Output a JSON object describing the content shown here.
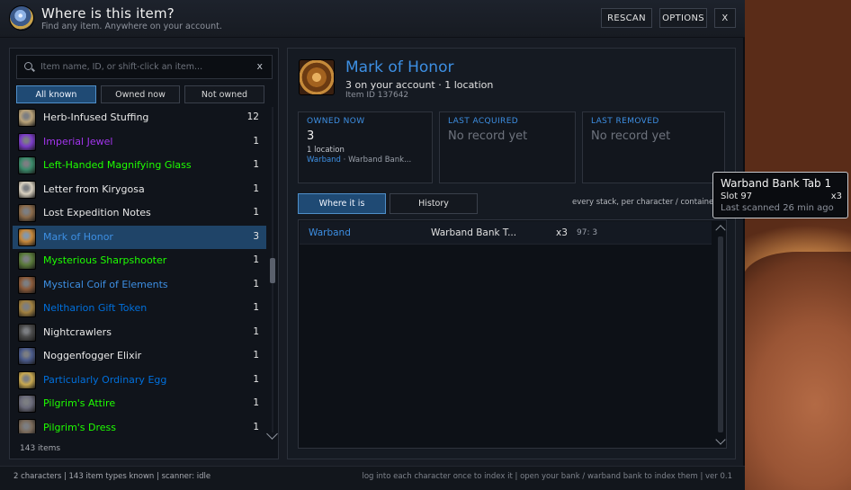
{
  "header": {
    "title": "Where is this item?",
    "subtitle": "Find any item. Anywhere on your account.",
    "rescan": "RESCAN",
    "options": "OPTIONS",
    "close": "X"
  },
  "search": {
    "placeholder": "Item name, ID, or shift-click an item...",
    "clear": "x"
  },
  "filters": [
    "All known",
    "Owned now",
    "Not owned"
  ],
  "items": [
    {
      "name": "Herb-Infused Stuffing",
      "count": "12",
      "color": "#e8e8e8",
      "icon": "stuffing-icon",
      "iconbg": "#b9a37a"
    },
    {
      "name": "Imperial Jewel",
      "count": "1",
      "color": "#a335ee",
      "icon": "jewel-icon",
      "iconbg": "#7a3cc8"
    },
    {
      "name": "Left-Handed Magnifying Glass",
      "count": "1",
      "color": "#1eff00",
      "icon": "magnifying-glass-icon",
      "iconbg": "#3a8a6a"
    },
    {
      "name": "Letter from Kirygosa",
      "count": "1",
      "color": "#e8e8e8",
      "icon": "letter-icon",
      "iconbg": "#d8d0c0"
    },
    {
      "name": "Lost Expedition Notes",
      "count": "1",
      "color": "#e8e8e8",
      "icon": "notes-icon",
      "iconbg": "#8a6a4a"
    },
    {
      "name": "Mark of Honor",
      "count": "3",
      "color": "#3d8fe3",
      "icon": "mark-of-honor-icon",
      "iconbg": "#c5873a",
      "selected": true
    },
    {
      "name": "Mysterious Sharpshooter",
      "count": "1",
      "color": "#1eff00",
      "icon": "sharpshooter-icon",
      "iconbg": "#5a7a3a"
    },
    {
      "name": "Mystical Coif of Elements",
      "count": "1",
      "color": "#3d8fe3",
      "icon": "coif-icon",
      "iconbg": "#8a5a3a"
    },
    {
      "name": "Neltharion Gift Token",
      "count": "1",
      "color": "#0070dd",
      "icon": "token-icon",
      "iconbg": "#a08040"
    },
    {
      "name": "Nightcrawlers",
      "count": "1",
      "color": "#e8e8e8",
      "icon": "nightcrawlers-icon",
      "iconbg": "#4a4a4a"
    },
    {
      "name": "Noggenfogger Elixir",
      "count": "1",
      "color": "#e8e8e8",
      "icon": "elixir-icon",
      "iconbg": "#4a5a8a"
    },
    {
      "name": "Particularly Ordinary Egg",
      "count": "1",
      "color": "#0070dd",
      "icon": "egg-icon",
      "iconbg": "#c8a850"
    },
    {
      "name": "Pilgrim's Attire",
      "count": "1",
      "color": "#1eff00",
      "icon": "attire-icon",
      "iconbg": "#6a6a7a"
    },
    {
      "name": "Pilgrim's Dress",
      "count": "1",
      "color": "#1eff00",
      "icon": "dress-icon",
      "iconbg": "#7a6a5a"
    }
  ],
  "item_count": "143 items",
  "detail": {
    "name": "Mark of Honor",
    "summary": "3 on your account  ·  1 location",
    "item_id": "Item ID 137642",
    "owned_label": "OWNED NOW",
    "owned_value": "3",
    "owned_locations": "1 location",
    "owned_loc_a": "Warband",
    "owned_loc_sep": "·",
    "owned_loc_b": "Warband Bank...",
    "acquired_label": "LAST ACQUIRED",
    "acquired_value": "No record yet",
    "removed_label": "LAST REMOVED",
    "removed_value": "No record yet"
  },
  "tabs": [
    "Where it is",
    "History"
  ],
  "hint": "every stack, per character / container",
  "table": [
    {
      "owner": "Warband",
      "container": "Warband Bank T...",
      "qty": "x3",
      "slot": "97: 3"
    }
  ],
  "tooltip": {
    "title": "Warband Bank Tab 1",
    "slot": "Slot 97",
    "qty": "x3",
    "scanned": "Last scanned 26 min ago"
  },
  "footer": {
    "left": "2 characters   |   143 item types known   |   scanner: idle",
    "right": "log into each character once to index it   |   open your bank / warband bank to index them   |   ver 0.1"
  },
  "colors": {
    "accent": "#3d8fe3",
    "selected_row": "#1f4468",
    "active_button": "#1f4a74"
  }
}
